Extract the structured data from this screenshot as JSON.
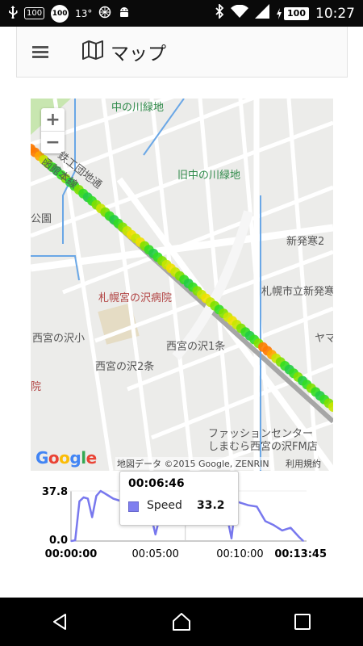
{
  "status_bar": {
    "badge1": "100",
    "badge2": "100",
    "temperature": "13°",
    "battery": "100",
    "time": "10:27",
    "icons": [
      "usb-icon",
      "notification-badge-icon",
      "app-badge-icon",
      "weather-icon",
      "globe-icon",
      "android-icon",
      "bluetooth-icon",
      "wifi-icon",
      "signal-icon",
      "battery-icon"
    ]
  },
  "app_bar": {
    "title": "マップ",
    "menu_icon": "hamburger-menu-icon",
    "title_icon": "map-icon"
  },
  "map": {
    "labels": {
      "nakanokawa": "中の川緑地",
      "tekkodan": "鉄工団地通",
      "hakodate": "函館本線",
      "kyunakanokawa": "旧中の川緑地",
      "koen": "公園",
      "shinhassamu": "新発寒2",
      "hospital": "札幌宮の沢病院",
      "shinhassamu_city": "札幌市立新発寒",
      "nishimiya_sho": "西宮の沢小",
      "nishimiya1": "西宮の沢1条",
      "nishimiya2": "西宮の沢2条",
      "yama": "ヤマ",
      "in": "院",
      "fashion": "ファッションセンター",
      "shimamura": "しまむら西宮の沢FM店"
    },
    "zoom_in": "+",
    "zoom_out": "−",
    "google": "Google",
    "attribution": "地図データ ©2015 Google, ZENRIN",
    "terms": "利用規約",
    "track_colors": [
      "#ff7a00",
      "#ffa500",
      "#f0e000",
      "#c8e600",
      "#7fe000",
      "#33dd22",
      "#22cc44"
    ]
  },
  "chart_data": {
    "type": "line",
    "series": [
      {
        "name": "Speed",
        "color": "#7878ee",
        "x": [
          "00:00:00",
          "00:00:15",
          "00:00:30",
          "00:00:45",
          "00:01:00",
          "00:01:15",
          "00:01:30",
          "00:01:45",
          "00:02:00",
          "00:02:30",
          "00:03:00",
          "00:03:30",
          "00:04:00",
          "00:04:30",
          "00:05:00",
          "00:05:30",
          "00:06:00",
          "00:06:46",
          "00:07:30",
          "00:08:00",
          "00:08:30",
          "00:09:00",
          "00:09:15",
          "00:09:30",
          "00:09:45",
          "00:10:00",
          "00:10:30",
          "00:11:00",
          "00:11:30",
          "00:12:00",
          "00:12:30",
          "00:13:00",
          "00:13:30",
          "00:13:45"
        ],
        "values": [
          0.0,
          0.5,
          30.0,
          33.0,
          32.0,
          18.0,
          34.0,
          37.8,
          36.0,
          32.0,
          30.0,
          31.0,
          28.0,
          32.0,
          5.0,
          31.0,
          29.0,
          33.2,
          26.0,
          22.0,
          36.0,
          33.0,
          18.0,
          2.0,
          30.0,
          29.0,
          27.0,
          26.0,
          15.0,
          12.0,
          8.0,
          10.0,
          3.0,
          0.0
        ]
      }
    ],
    "ylim": [
      0.0,
      37.8
    ],
    "y_ticks": [
      "37.8",
      "0.0"
    ],
    "x_ticks": [
      "00:00:00",
      "00:05:00",
      "00:10:00",
      "00:13:45"
    ],
    "tooltip": {
      "time": "00:06:46",
      "series": "Speed",
      "value": "33.2"
    }
  },
  "nav_bar": {
    "icons": [
      "back-icon",
      "home-icon",
      "recents-icon"
    ]
  }
}
